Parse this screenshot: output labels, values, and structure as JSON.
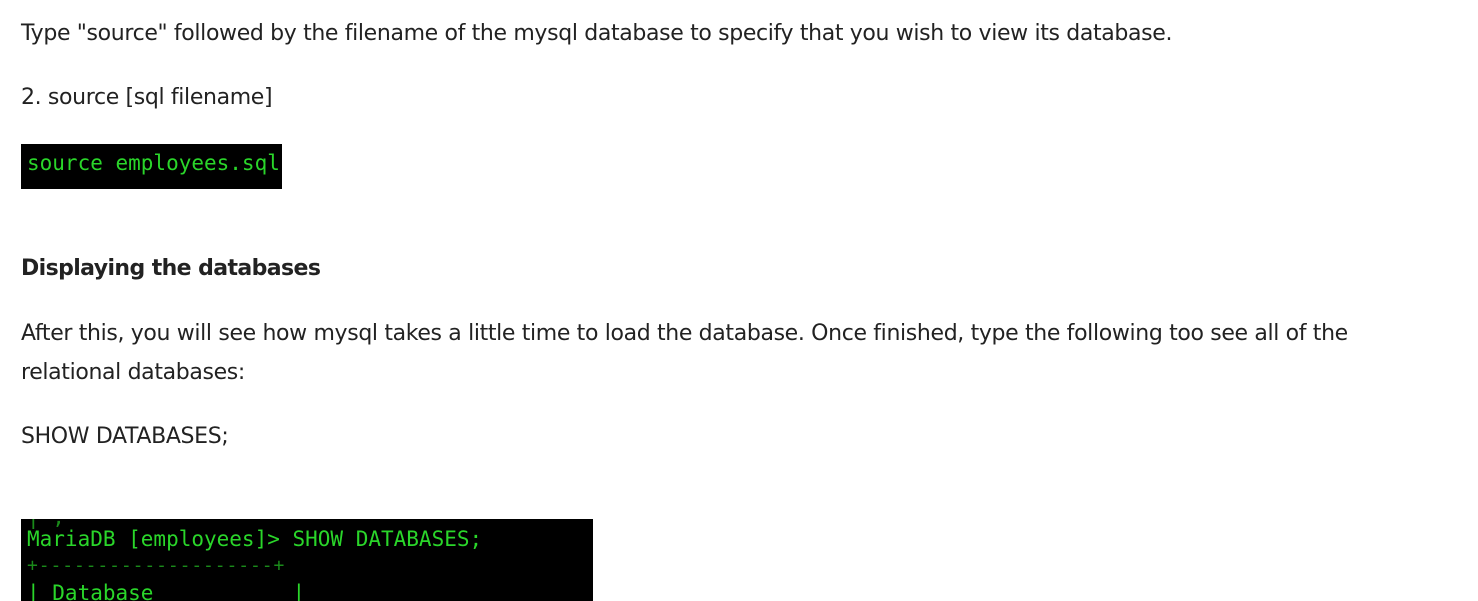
{
  "article": {
    "intro_text": "Type \"source\" followed by the filename of the mysql database to specify that you wish to view its database.",
    "step_text": "2. source [sql filename]",
    "terminal_source": {
      "command": "source employees.sql"
    },
    "section_heading": "Displaying the databases",
    "after_text": "After this, you will see how mysql takes a little time to load the database. Once finished, type the following too see all of the relational databases:",
    "show_command_text": "SHOW DATABASES;",
    "terminal_show": {
      "prompt_line": "MariaDB [employees]> SHOW DATABASES;",
      "border_line": "+--------------------+",
      "header_line": "| Database           |"
    }
  },
  "colors": {
    "text": "#222222",
    "terminal_bg": "#000000",
    "terminal_text": "#2ad62a"
  }
}
